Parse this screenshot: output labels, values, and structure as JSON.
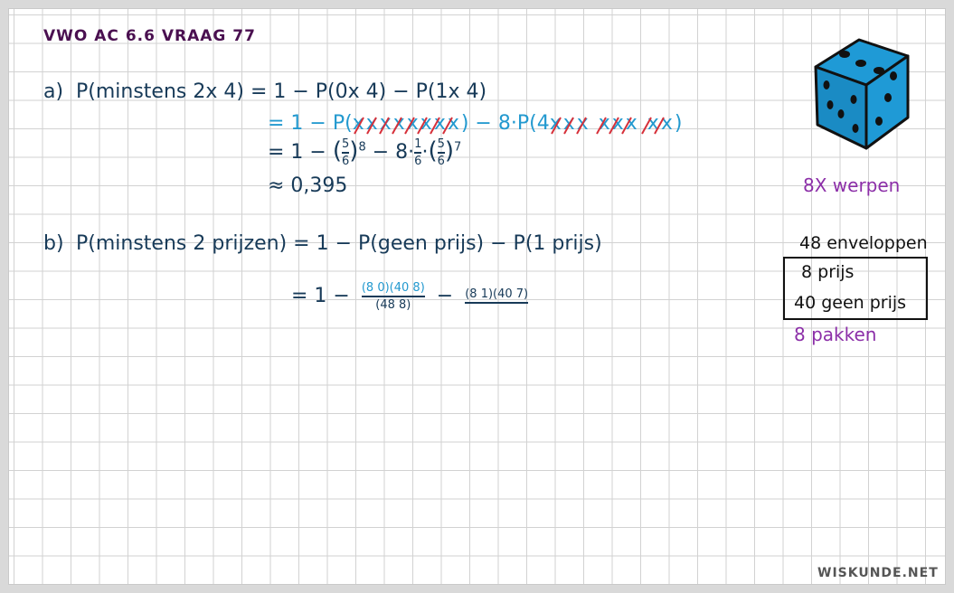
{
  "title": "VWO AC 6.6 VRAAG 77",
  "part_a": {
    "label": "a)",
    "line1": "P(minstens 2x 4) = 1 − P(0x 4) − P(1x 4)",
    "line2_prefix": "= 1 − P(",
    "line2_crossed1": "xxxxxxxx",
    "line2_middle": ") − 8·P(4",
    "line2_crossed2": "xxx xxx xx",
    "line2_suffix": ")",
    "line3_prefix": "= 1 −",
    "line3_frac_num": "5",
    "line3_frac_den": "6",
    "line3_exp1": "8",
    "line3_mid": "− 8·",
    "line3_frac2_num": "1",
    "line3_frac2_den": "6",
    "line3_dot": "·",
    "line3_exp2": "7",
    "line4": "≈ 0,395"
  },
  "part_b": {
    "label": "b)",
    "line1": "P(minstens 2 prijzen) = 1 − P(geen prijs) − P(1 prijs)",
    "line2_prefix": "= 1 −",
    "frac1_num": "(8 0)(40 8)",
    "frac1_den": "(48 8)",
    "minus": "−",
    "frac2_num": "(8 1)(40 7)",
    "frac2_den": ""
  },
  "sidebar": {
    "throws": "8X werpen",
    "envelopes": "48 enveloppen",
    "prizes": "8  prijs",
    "no_prizes": "40 geen prijs",
    "packs": "8 pakken"
  },
  "watermark": "WISKUNDE.NET",
  "colors": {
    "title": "#4a1050",
    "navy": "#173a58",
    "cyan": "#2399cf",
    "purple": "#8c2fa8",
    "die": "#1f9ad6",
    "cross": "#d6303a"
  },
  "icons": [
    "die-icon"
  ]
}
